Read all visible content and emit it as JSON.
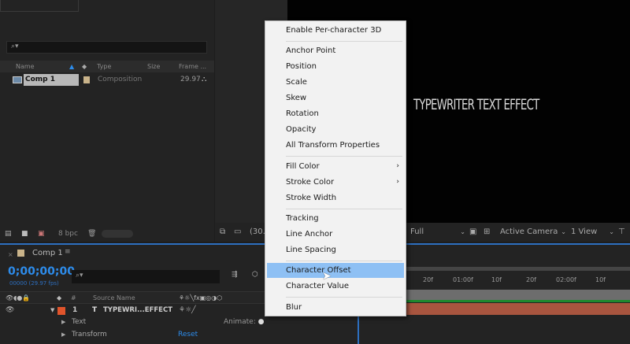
{
  "project_panel": {
    "search_icon": "search-icon",
    "columns": [
      "Name",
      "Type",
      "Size",
      "Frame ..."
    ],
    "items": [
      {
        "name": "Comp 1",
        "type": "Composition",
        "frame_rate": "29.97"
      }
    ],
    "bit_depth": "8 bpc"
  },
  "viewer": {
    "comp_text": "TYPEWRITER TEXT EFFECT",
    "zoom": "(30.",
    "resolution": "Full",
    "camera": "Active Camera",
    "views": "1 View"
  },
  "timeline": {
    "tab_label": "Comp 1",
    "timecode": "0;00;00;00",
    "timecode_sub": "00000 (29.97 fps)",
    "header": {
      "number": "#",
      "source_name": "Source Name"
    },
    "layer": {
      "index": "1",
      "name": "TYPEWRI...EFFECT"
    },
    "text_group": "Text",
    "animate_label": "Animate:",
    "transform_group": "Transform",
    "reset_label": "Reset",
    "ruler_ticks": [
      "20f",
      "01:00f",
      "10f",
      "20f",
      "02:00f",
      "10f"
    ]
  },
  "context_menu": {
    "items": [
      {
        "label": "Enable Per-character 3D"
      },
      {
        "label": "Anchor Point"
      },
      {
        "label": "Position"
      },
      {
        "label": "Scale"
      },
      {
        "label": "Skew"
      },
      {
        "label": "Rotation"
      },
      {
        "label": "Opacity"
      },
      {
        "label": "All Transform Properties"
      },
      {
        "label": "Fill Color",
        "submenu": "›"
      },
      {
        "label": "Stroke Color",
        "submenu": "›"
      },
      {
        "label": "Stroke Width"
      },
      {
        "label": "Tracking"
      },
      {
        "label": "Line Anchor"
      },
      {
        "label": "Line Spacing"
      },
      {
        "label": "Character Offset",
        "highlighted": true
      },
      {
        "label": "Character Value"
      },
      {
        "label": "Blur"
      }
    ]
  },
  "colors": {
    "accent": "#2d8ceb",
    "highlight": "#8ec0f4",
    "layer_label": "#e0542b",
    "layer_bar": "#a8553f",
    "comp_label": "#c9b38a"
  }
}
